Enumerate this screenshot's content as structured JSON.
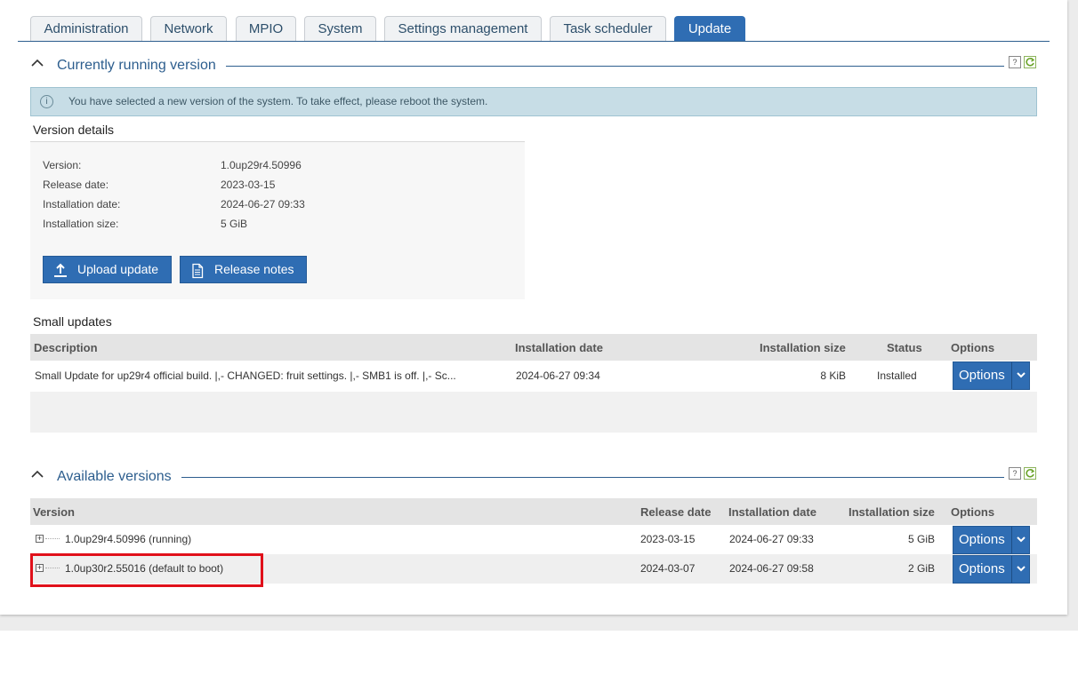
{
  "tabs": [
    "Administration",
    "Network",
    "MPIO",
    "System",
    "Settings management",
    "Task scheduler",
    "Update"
  ],
  "active_tab": "Update",
  "running": {
    "title": "Currently running version",
    "info": "You have selected a new version of the system. To take effect, please reboot the system.",
    "details_title": "Version details",
    "labels": {
      "version": "Version:",
      "release_date": "Release date:",
      "installation_date": "Installation date:",
      "installation_size": "Installation size:"
    },
    "values": {
      "version": "1.0up29r4.50996",
      "release_date": "2023-03-15",
      "installation_date": "2024-06-27 09:33",
      "installation_size": "5 GiB"
    },
    "upload_label": "Upload update",
    "notes_label": "Release notes"
  },
  "small_updates": {
    "title": "Small updates",
    "columns": [
      "Description",
      "Installation date",
      "Installation size",
      "Status",
      "Options"
    ],
    "rows": [
      {
        "description": "Small Update for up29r4 official build. |,- CHANGED: fruit settings. |,- SMB1 is off. |,- Sc...",
        "installation_date": "2024-06-27 09:34",
        "size": "8 KiB",
        "status": "Installed",
        "options": "Options"
      }
    ]
  },
  "available": {
    "title": "Available versions",
    "columns": [
      "Version",
      "Release date",
      "Installation date",
      "Installation size",
      "Options"
    ],
    "rows": [
      {
        "version": "1.0up29r4.50996 (running)",
        "release_date": "2023-03-15",
        "installation_date": "2024-06-27 09:33",
        "size": "5 GiB",
        "options": "Options"
      },
      {
        "version": "1.0up30r2.55016 (default to boot)",
        "release_date": "2024-03-07",
        "installation_date": "2024-06-27 09:58",
        "size": "2 GiB",
        "options": "Options"
      }
    ]
  },
  "icons": {
    "collapse": "chevron-up-icon",
    "help": "help-icon",
    "refresh": "refresh-icon",
    "info": "info-icon",
    "upload": "upload-icon",
    "notes": "document-icon",
    "expand": "plus-box-icon",
    "dropdown": "chevron-down-icon"
  },
  "colors": {
    "accent": "#2f6db3",
    "header_text": "#2d5e8e",
    "info_bg": "#c7dde6",
    "highlight": "#e0101a"
  }
}
